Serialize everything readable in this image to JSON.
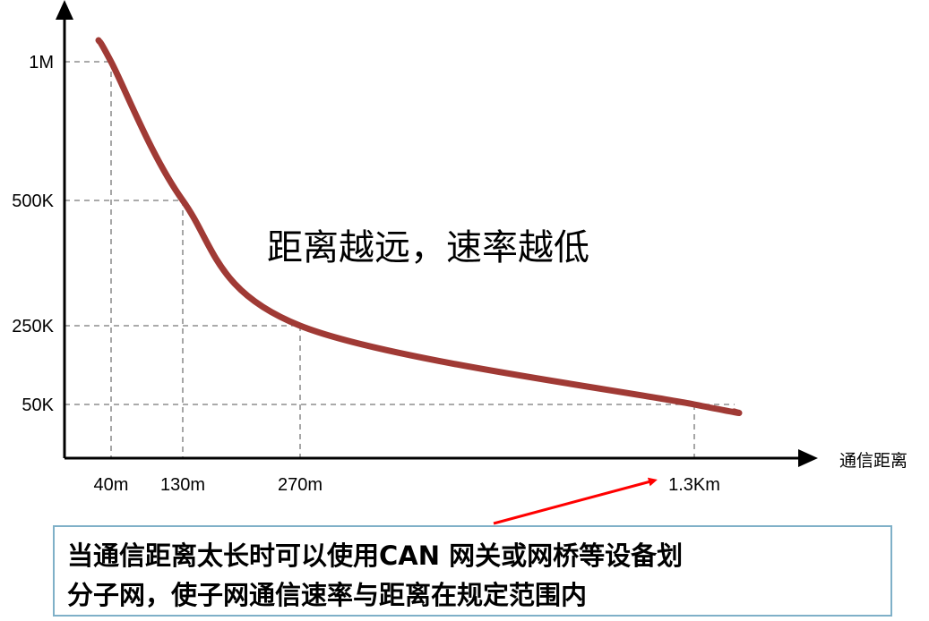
{
  "chart_data": {
    "type": "line",
    "xlabel": "通信距离",
    "ylabel": "",
    "x_ticks": [
      "40m",
      "130m",
      "270m",
      "1.3Km"
    ],
    "y_ticks": [
      "1M",
      "500K",
      "250K",
      "50K"
    ],
    "grid": "dashed reference lines at each tick",
    "series": [
      {
        "color": "#a03a35",
        "points": [
          {
            "x": "40m",
            "y": "1M"
          },
          {
            "x": "130m",
            "y": "500K"
          },
          {
            "x": "270m",
            "y": "250K"
          },
          {
            "x": "1.3Km",
            "y": "50K"
          }
        ]
      }
    ],
    "annotation": "距离越远，速率越低"
  },
  "note": {
    "line1": "当通信距离太长时可以使用CAN 网关或网桥等设备划",
    "line2": "分子网，使子网通信速率与距离在规定范围内",
    "arrow_color": "#ff0000",
    "border_color": "#7fb0c8"
  }
}
